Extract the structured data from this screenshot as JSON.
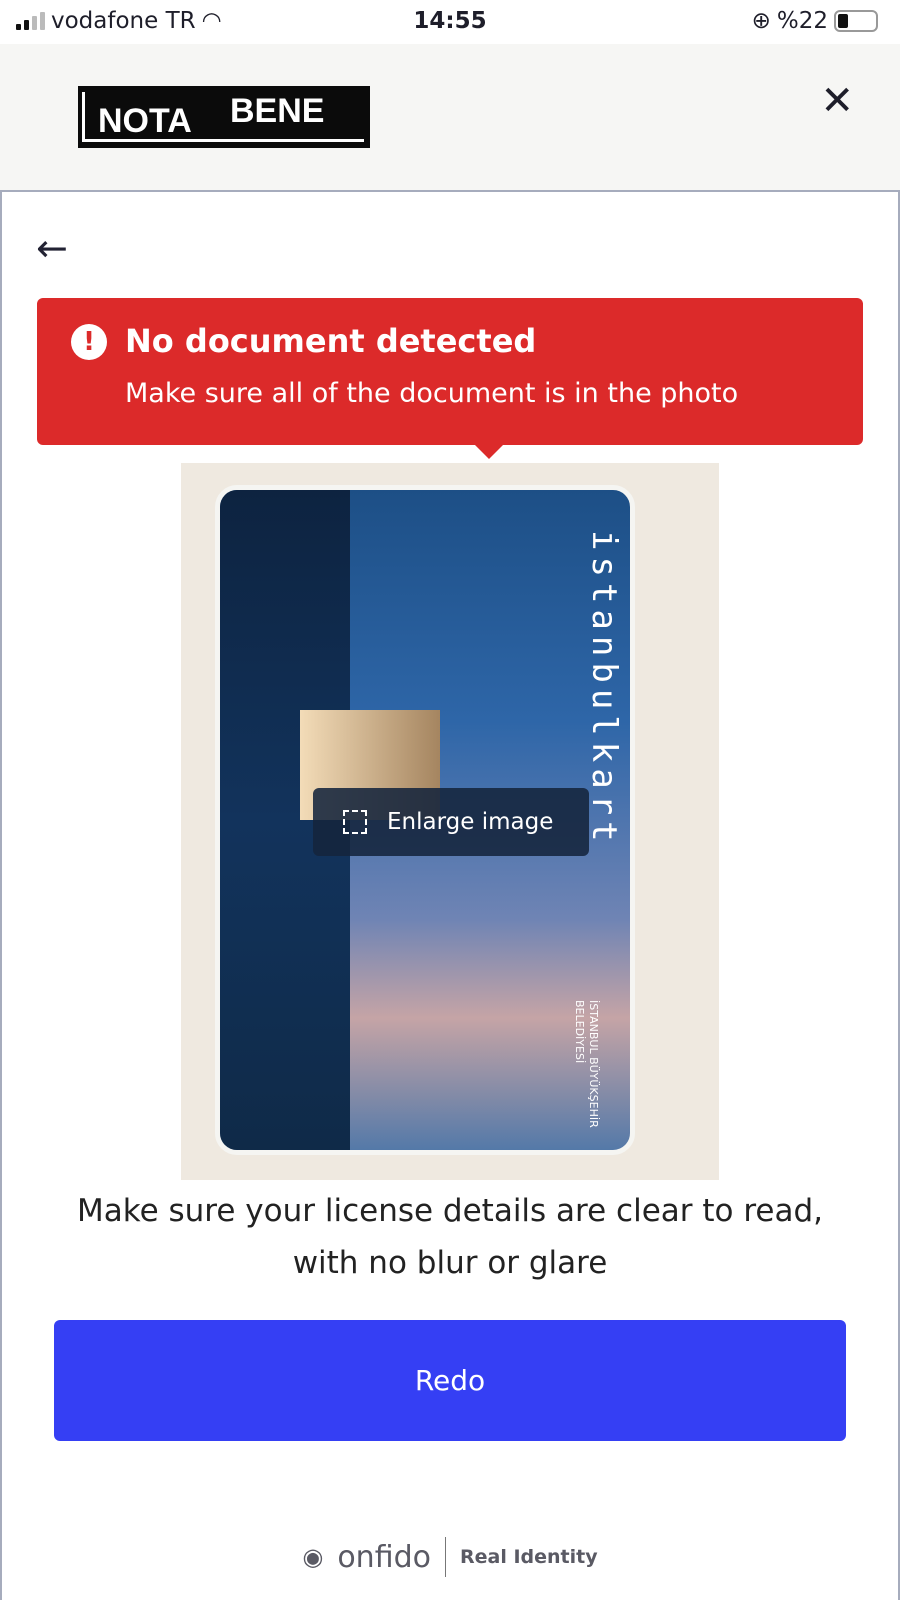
{
  "status": {
    "carrier": "vodafone TR",
    "time": "14:55",
    "battery": "%22"
  },
  "header": {
    "logo_left": "NOTA",
    "logo_right": "BENE",
    "close": "✕"
  },
  "nav": {
    "back": "←"
  },
  "alert": {
    "icon": "!",
    "title": "No document detected",
    "message": "Make sure all of the document is in the photo"
  },
  "photo": {
    "card_brand": "istanbulkart",
    "card_issuer": "İSTANBUL BÜYÜKŞEHİR BELEDİYESİ",
    "enlarge_label": "Enlarge image"
  },
  "hint": "Make sure your license details are clear to read, with no blur or glare",
  "redo_label": "Redo",
  "footer": {
    "brand": "onfido",
    "tagline": "Real Identity"
  },
  "colors": {
    "alert": "#dc2a2a",
    "button": "#353ff4"
  }
}
